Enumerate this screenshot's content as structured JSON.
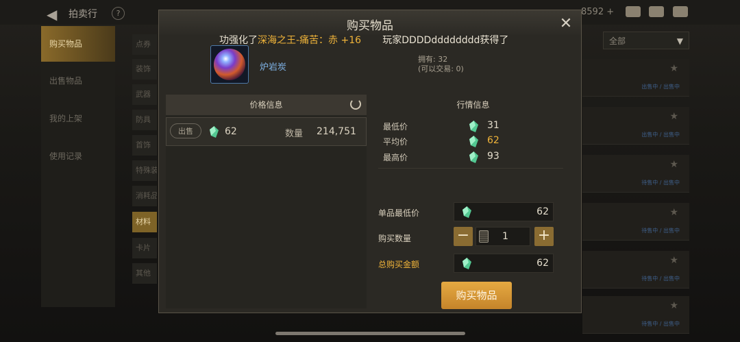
{
  "topbar": {
    "title": "拍卖行",
    "help": "?",
    "currency": "8592 +"
  },
  "leftnav": [
    "购买物品",
    "出售物品",
    "我的上架",
    "使用记录"
  ],
  "subnav": [
    "点券",
    "装饰",
    "武器",
    "防具",
    "首饰",
    "特殊装",
    "消耗品",
    "材料",
    "卡片",
    "其他"
  ],
  "filter": {
    "value": "全部"
  },
  "side_rows": [
    "出售中 / 出售中",
    "出售中 / 出售中",
    "待售中 / 出售中",
    "待售中 / 出售中",
    "待售中 / 出售中",
    "待售中 / 出售中"
  ],
  "modal": {
    "title": "购买物品",
    "ticker": {
      "prefix": "功强化了",
      "item": "深海之王-痛苦：赤 +16",
      "suffix": "玩家DDDDdddddddd获得了"
    },
    "item": {
      "name": "炉岩炭",
      "owned": "拥有: 32",
      "tradable": "(可以交易: 0)"
    },
    "price_panel": {
      "title": "价格信息",
      "sell_label": "出售",
      "price": "62",
      "qty_label": "数量",
      "qty": "214,751"
    },
    "market_panel": {
      "title": "行情信息",
      "rows": [
        {
          "label": "最低价",
          "value": "31"
        },
        {
          "label": "平均价",
          "value": "62"
        },
        {
          "label": "最高价",
          "value": "93"
        }
      ]
    },
    "form": {
      "unit_label": "单品最低价",
      "unit_value": "62",
      "qty_label": "购买数量",
      "qty_value": "1",
      "total_label": "总购买金额",
      "total_value": "62",
      "buy_label": "购买物品"
    }
  },
  "colors": {
    "gold": "#f0b43a",
    "accent": "#c5842a",
    "gem": "#53c892"
  }
}
